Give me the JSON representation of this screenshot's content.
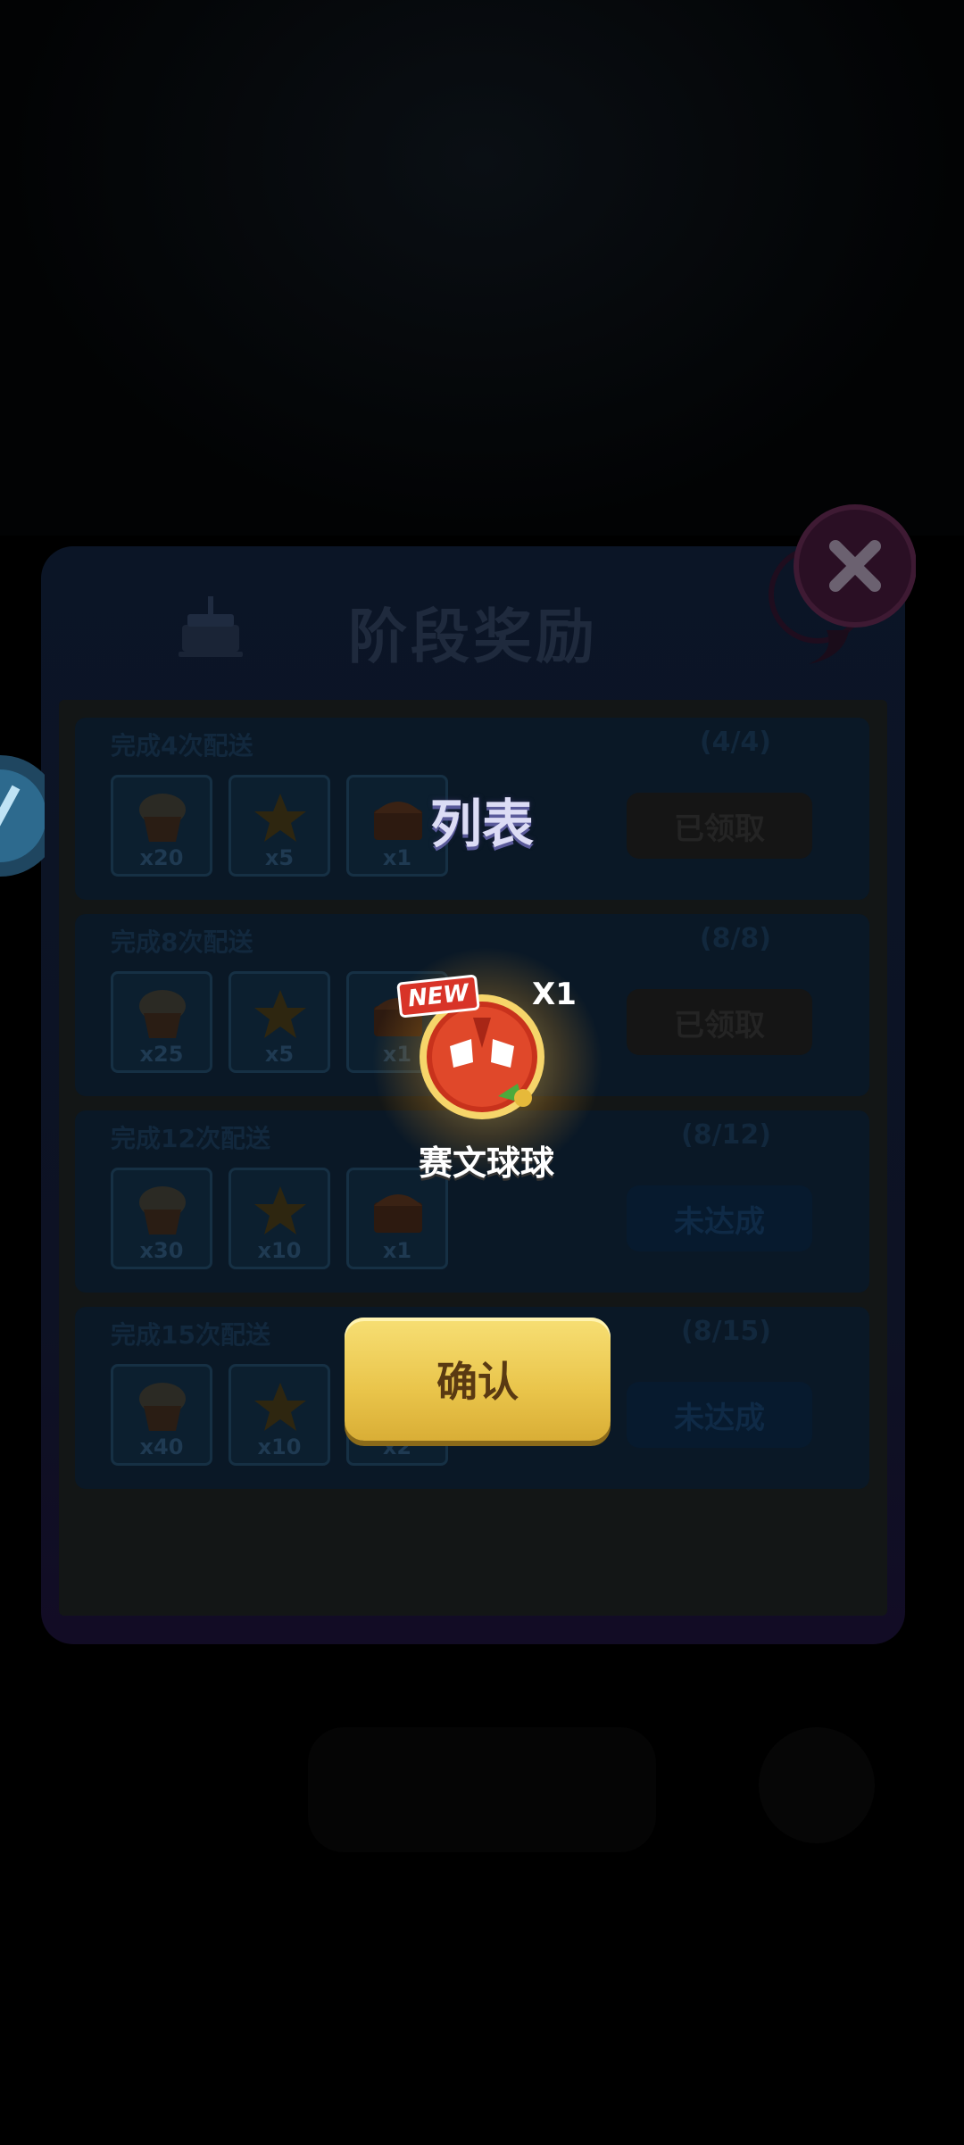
{
  "panel": {
    "title": "阶段奖励",
    "rows": [
      {
        "title": "完成4次配送",
        "progress": "(4/4)",
        "status": "已领取",
        "state": "claimed",
        "items": [
          {
            "icon": "cupcake-icon",
            "qty": "x20"
          },
          {
            "icon": "star-icon",
            "qty": "x5"
          },
          {
            "icon": "chest-icon",
            "qty": "x1"
          }
        ]
      },
      {
        "title": "完成8次配送",
        "progress": "(8/8)",
        "status": "已领取",
        "state": "claimed",
        "items": [
          {
            "icon": "cupcake-icon",
            "qty": "x25"
          },
          {
            "icon": "star-icon",
            "qty": "x5"
          },
          {
            "icon": "chest-icon",
            "qty": "x1"
          }
        ]
      },
      {
        "title": "完成12次配送",
        "progress": "(8/12)",
        "status": "未达成",
        "state": "pending",
        "items": [
          {
            "icon": "cupcake-icon",
            "qty": "x30"
          },
          {
            "icon": "star-icon",
            "qty": "x10"
          },
          {
            "icon": "chest-icon",
            "qty": "x1"
          }
        ]
      },
      {
        "title": "完成15次配送",
        "progress": "(8/15)",
        "status": "未达成",
        "state": "pending",
        "items": [
          {
            "icon": "cupcake-icon",
            "qty": "x40"
          },
          {
            "icon": "star-icon",
            "qty": "x10"
          },
          {
            "icon": "chest-icon",
            "qty": "x2"
          }
        ]
      }
    ]
  },
  "modal": {
    "title": "列表",
    "reward": {
      "badge": "NEW",
      "qty": "X1",
      "name": "赛文球球",
      "icon": "seven-ball-icon"
    },
    "confirm_label": "确认"
  },
  "colors": {
    "confirm": "#f0d25c",
    "modal_title": "#dcdcf5",
    "badge": "#d83428"
  }
}
